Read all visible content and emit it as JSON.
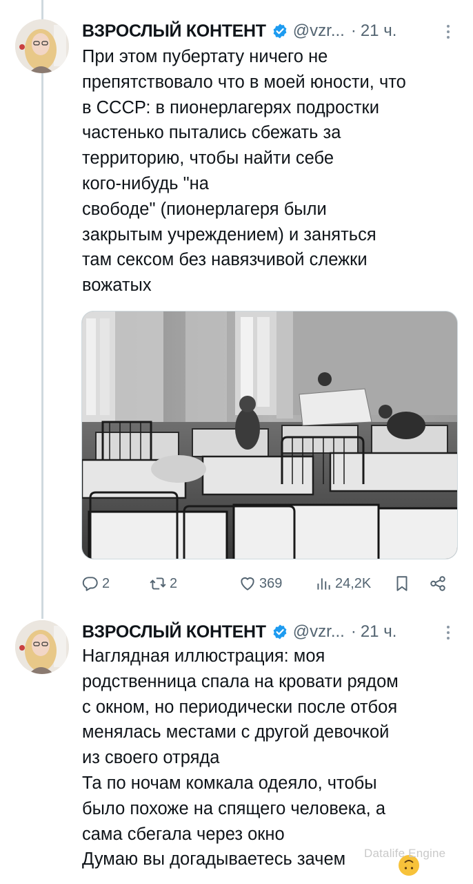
{
  "tweets": [
    {
      "author_name": "ВЗРОСЛЫЙ КОНТЕНТ",
      "handle": "@vzr...",
      "separator": "·",
      "time": "21 ч.",
      "text_lines": [
        "При этом пубертату ничего не",
        "препятствовало что в моей юности, что",
        "в СССР: в пионерлагерях подростки",
        "частенько пытались сбежать за",
        "территорию, чтобы найти себе",
        "кого-нибудь \"на",
        "свободе\" (пионерлагеря были",
        "закрытым учреждением) и заняться",
        "там сексом без навязчивой слежки",
        "вожатых"
      ],
      "actions": {
        "replies": "2",
        "retweets": "2",
        "likes": "369",
        "views": "24,2K"
      }
    },
    {
      "author_name": "ВЗРОСЛЫЙ КОНТЕНТ",
      "handle": "@vzr...",
      "separator": "·",
      "time": "21 ч.",
      "text_lines": [
        "Наглядная иллюстрация: моя",
        "родственница спала на кровати рядом",
        "с окном, но периодически после отбоя",
        "менялась местами с другой девочкой",
        "из своего отряда",
        "Та по ночам комкала одеяло, чтобы",
        "было похоже на спящего человека, а",
        "сама сбегала через окно",
        "Думаю вы догадываетесь зачем"
      ]
    }
  ],
  "watermark": "Datalife Engine",
  "colors": {
    "verified": "#1d9bf0",
    "muted": "#536471",
    "thread_line": "#cfd9de"
  },
  "icons": [
    "reply-icon",
    "retweet-icon",
    "like-icon",
    "views-icon",
    "bookmark-icon",
    "share-icon",
    "verified-icon",
    "more-icon"
  ]
}
